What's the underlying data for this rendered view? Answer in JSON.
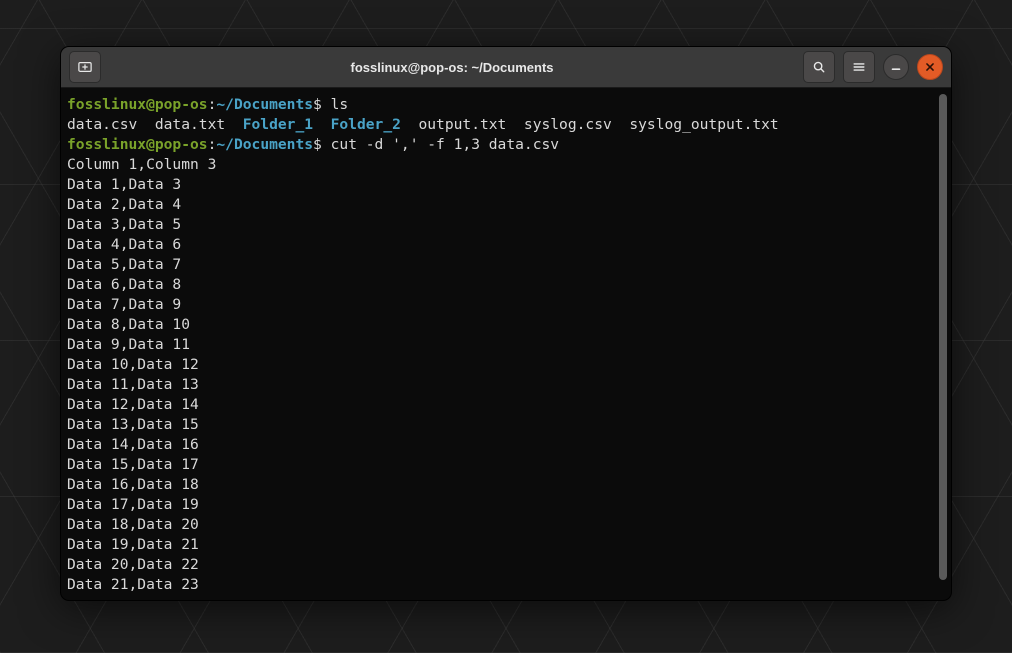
{
  "titlebar": {
    "title": "fosslinux@pop-os: ~/Documents",
    "new_tab_icon": "new-tab-icon",
    "search_icon": "search-icon",
    "menu_icon": "hamburger-menu-icon",
    "minimize_icon": "minimize-icon",
    "close_icon": "close-icon"
  },
  "prompt": {
    "user": "fosslinux@pop-os",
    "separator": ":",
    "path": "~/Documents",
    "symbol": "$ "
  },
  "cmd1": "ls",
  "ls_output": {
    "files1": "data.csv  data.txt  ",
    "dir1": "Folder_1",
    "spacer1": "  ",
    "dir2": "Folder_2",
    "files2": "  output.txt  syslog.csv  syslog_output.txt"
  },
  "cmd2": "cut -d ',' -f 1,3 data.csv",
  "cut_output": [
    "Column 1,Column 3",
    "Data 1,Data 3",
    "Data 2,Data 4",
    "Data 3,Data 5",
    "Data 4,Data 6",
    "Data 5,Data 7",
    "Data 6,Data 8",
    "Data 7,Data 9",
    "Data 8,Data 10",
    "Data 9,Data 11",
    "Data 10,Data 12",
    "Data 11,Data 13",
    "Data 12,Data 14",
    "Data 13,Data 15",
    "Data 14,Data 16",
    "Data 15,Data 17",
    "Data 16,Data 18",
    "Data 17,Data 19",
    "Data 18,Data 20",
    "Data 19,Data 21",
    "Data 20,Data 22",
    "Data 21,Data 23"
  ]
}
